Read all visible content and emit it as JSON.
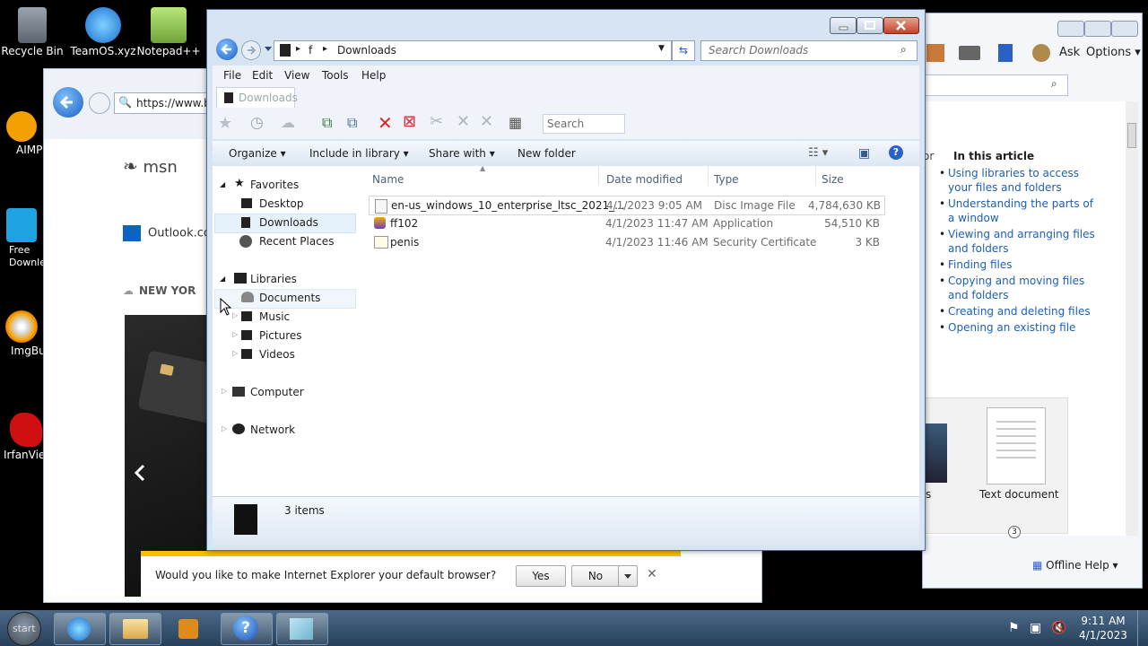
{
  "desktop": {
    "icons": [
      {
        "label": "Recycle Bin"
      },
      {
        "label": "TeamOS.xyz"
      },
      {
        "label": "Notepad++"
      },
      {
        "label": "AIMP"
      },
      {
        "label": "Free Downle"
      },
      {
        "label": "ImgBu"
      },
      {
        "label": "IrfanView"
      }
    ]
  },
  "ie": {
    "url": "https://www.b",
    "brand": "msn",
    "outlook": "Outlook.co",
    "weather": "NEW YOR",
    "prompt": {
      "text": "Would you like to make Internet Explorer your default browser?",
      "yes": "Yes",
      "no": "No"
    }
  },
  "help": {
    "ask": "Ask",
    "options": "Options",
    "or": "or",
    "article_heading": "In this article",
    "links": [
      "Using libraries to access your files and folders",
      "Understanding the parts of a window",
      "Viewing and arranging files and folders",
      "Finding files",
      "Copying and moving files and folders",
      "Creating and deleting files",
      "Opening an existing file"
    ],
    "thumb_label_left": "s",
    "thumb_label": "Text document",
    "page_num": "3",
    "offline_help": "Offline Help"
  },
  "explorer": {
    "breadcrumb": [
      "f",
      "Downloads"
    ],
    "search_placeholder": "Search Downloads",
    "menu": [
      "File",
      "Edit",
      "View",
      "Tools",
      "Help"
    ],
    "tab": "Downloads",
    "toolbar_search_placeholder": "Search",
    "commands": {
      "organize": "Organize",
      "include": "Include in library",
      "share": "Share with",
      "newfolder": "New folder"
    },
    "nav": {
      "favorites": "Favorites",
      "desktop": "Desktop",
      "downloads": "Downloads",
      "recent": "Recent Places",
      "libraries": "Libraries",
      "documents": "Documents",
      "music": "Music",
      "pictures": "Pictures",
      "videos": "Videos",
      "computer": "Computer",
      "network": "Network"
    },
    "columns": {
      "name": "Name",
      "date": "Date modified",
      "type": "Type",
      "size": "Size"
    },
    "files": [
      {
        "name": "en-us_windows_10_enterprise_ltsc_2021_...",
        "date": "4/1/2023 9:05 AM",
        "type": "Disc Image File",
        "size": "4,784,630 KB"
      },
      {
        "name": "ff102",
        "date": "4/1/2023 11:47 AM",
        "type": "Application",
        "size": "54,510 KB"
      },
      {
        "name": "penis",
        "date": "4/1/2023 11:46 AM",
        "type": "Security Certificate",
        "size": "3 KB"
      }
    ],
    "status": "3 items"
  },
  "taskbar": {
    "start": "start",
    "time": "9:11 AM",
    "date": "4/1/2023"
  },
  "colors": {
    "accent": "#1f5fb2",
    "selection": "#cce8ff",
    "taskbar": "#34506e"
  }
}
